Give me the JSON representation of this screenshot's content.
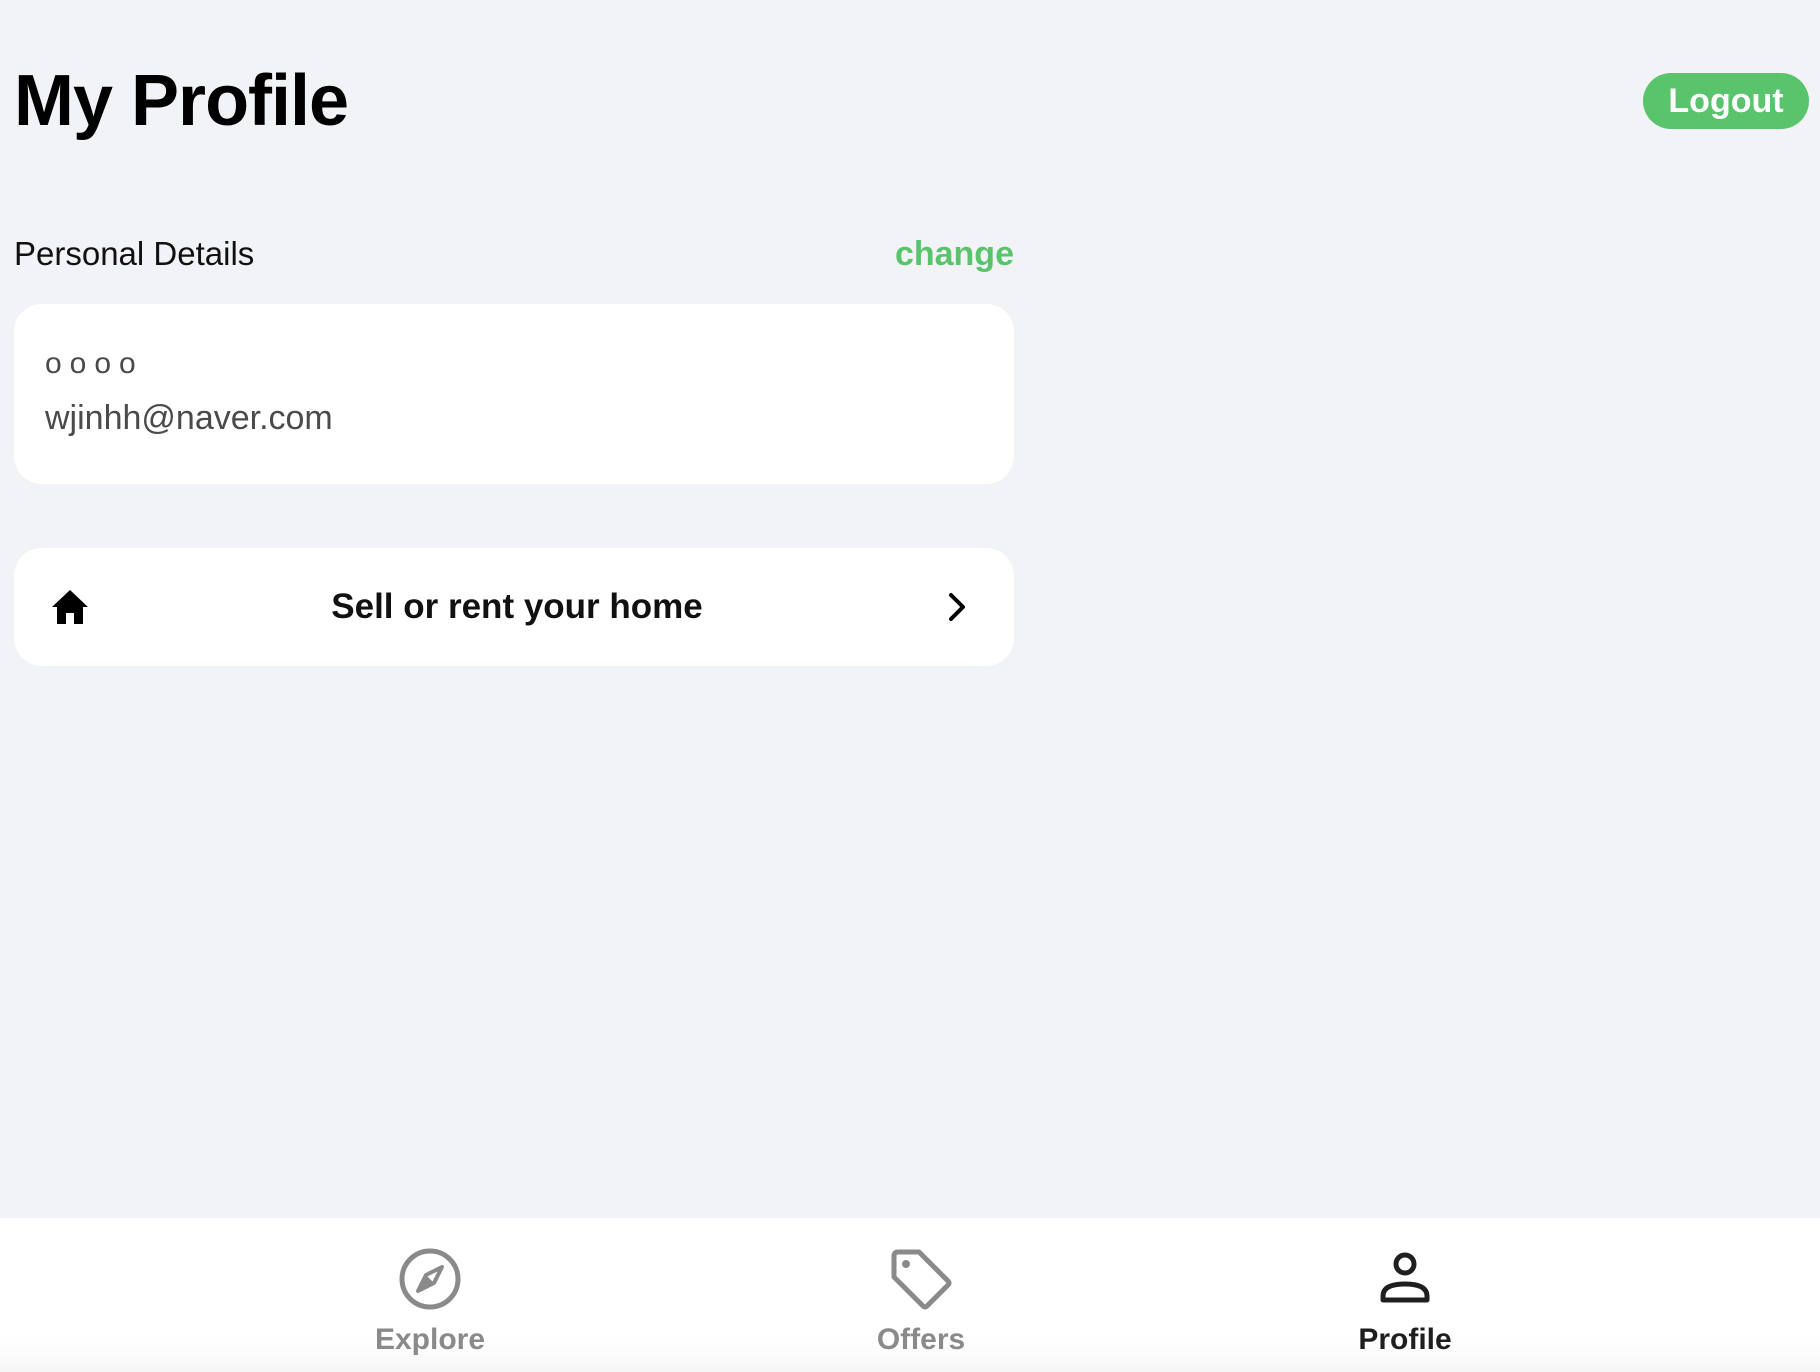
{
  "header": {
    "title": "My Profile",
    "logout_label": "Logout"
  },
  "personal_details": {
    "section_label": "Personal Details",
    "change_label": "change",
    "name": "oooo",
    "email": "wjinhh@naver.com"
  },
  "sell_row": {
    "label": "Sell or rent your home",
    "icon": "home-icon",
    "trailing_icon": "chevron-right-icon"
  },
  "bottom_nav": {
    "items": [
      {
        "label": "Explore",
        "icon": "compass-icon",
        "active": false
      },
      {
        "label": "Offers",
        "icon": "tag-icon",
        "active": false
      },
      {
        "label": "Profile",
        "icon": "person-icon",
        "active": true
      }
    ]
  },
  "colors": {
    "accent_green": "#5ac46c",
    "background": "#f2f3f7",
    "card": "#ffffff",
    "inactive_nav": "#8a8a8a",
    "active_nav": "#1f1f1f"
  }
}
